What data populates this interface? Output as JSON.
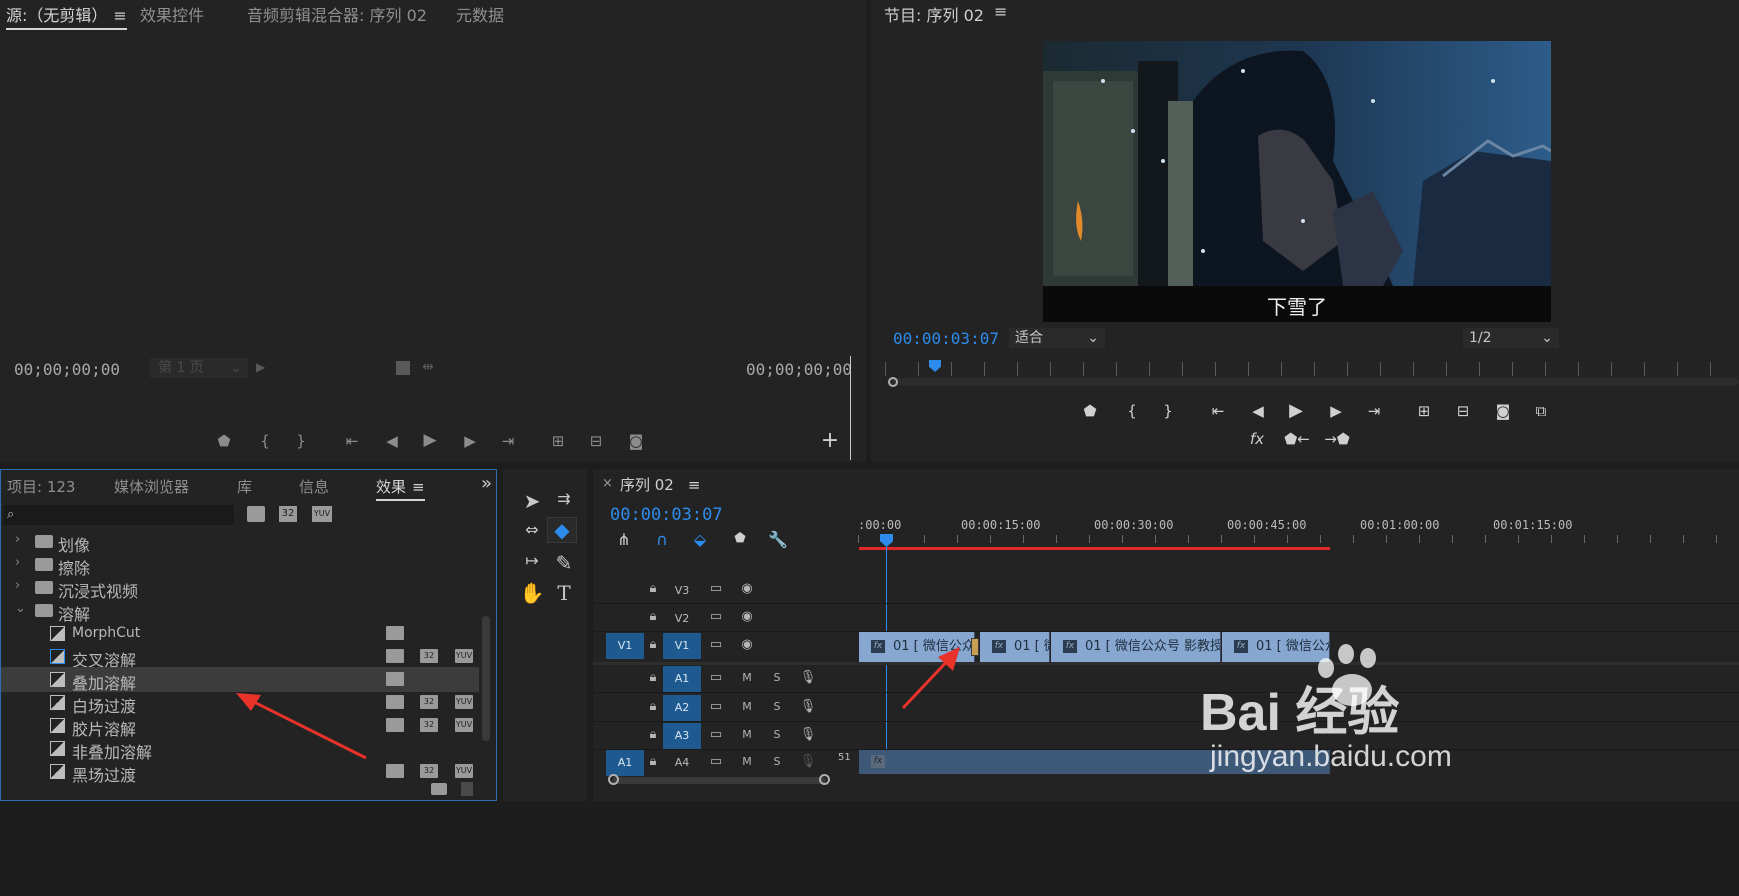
{
  "source": {
    "tabs": [
      {
        "label": "源:（无剪辑）",
        "active": true
      },
      {
        "label": "效果控件"
      },
      {
        "label": "音频剪辑混合器: 序列 02"
      },
      {
        "label": "元数据"
      }
    ],
    "menu_glyph": "≡",
    "timecode_left": "00;00;00;00",
    "timecode_right": "00;00;00;00",
    "page_select": "第 1 页",
    "add_glyph": "+"
  },
  "program": {
    "title": "节目: 序列 02",
    "menu_glyph": "≡",
    "subtitle": "下雪了",
    "timecode": "00:00:03:07",
    "fit_select": "适合",
    "quality_select": "1/2",
    "fx_label": "fx"
  },
  "project": {
    "tabs": [
      {
        "label": "项目: 123"
      },
      {
        "label": "媒体浏览器"
      },
      {
        "label": "库"
      },
      {
        "label": "信息"
      },
      {
        "label": "效果",
        "active": true
      }
    ],
    "menu_glyph": "≡",
    "overflow_glyph": "»",
    "search_placeholder": "",
    "filter_badges": [
      "32",
      "YUV"
    ],
    "items": [
      {
        "label": "划像",
        "type": "folder",
        "expanded": false
      },
      {
        "label": "擦除",
        "type": "folder",
        "expanded": false
      },
      {
        "label": "沉浸式视频",
        "type": "folder",
        "expanded": false
      },
      {
        "label": "溶解",
        "type": "folder",
        "expanded": true
      },
      {
        "label": "MorphCut",
        "type": "effect",
        "badges": [
          "accel"
        ]
      },
      {
        "label": "交叉溶解",
        "type": "effect",
        "badges": [
          "accel",
          "32",
          "YUV"
        ]
      },
      {
        "label": "叠加溶解",
        "type": "effect",
        "badges": [
          "accel"
        ],
        "selected": true
      },
      {
        "label": "白场过渡",
        "type": "effect",
        "badges": [
          "accel",
          "32",
          "YUV"
        ]
      },
      {
        "label": "胶片溶解",
        "type": "effect",
        "badges": [
          "accel",
          "32",
          "YUV"
        ]
      },
      {
        "label": "非叠加溶解",
        "type": "effect",
        "badges": []
      },
      {
        "label": "黑场过渡",
        "type": "effect",
        "badges": [
          "accel",
          "32",
          "YUV"
        ]
      }
    ]
  },
  "sequence": {
    "close_glyph": "×",
    "title": "序列 02",
    "menu_glyph": "≡",
    "timecode": "00:00:03:07",
    "ruler": [
      ":00:00",
      "00:00:15:00",
      "00:00:30:00",
      "00:00:45:00",
      "00:01:00:00",
      "00:01:15:00"
    ],
    "video_tracks": [
      {
        "name": "V3"
      },
      {
        "name": "V2"
      },
      {
        "name": "V1",
        "source": "V1"
      }
    ],
    "audio_tracks": [
      {
        "name": "A1",
        "m": "M",
        "s": "S"
      },
      {
        "name": "A2",
        "m": "M",
        "s": "S"
      },
      {
        "name": "A3",
        "m": "M",
        "s": "S"
      },
      {
        "name": "A4",
        "source": "A1",
        "m": "M",
        "s": "S",
        "level": "51"
      }
    ],
    "clips": [
      {
        "label": "01 [ 微信公众"
      },
      {
        "label": "01 [ 微"
      },
      {
        "label": "01 [ 微信公众号 影教授 ]"
      },
      {
        "label": "01 [ 微信公众"
      }
    ],
    "fx_badge": "fx"
  },
  "watermark": {
    "text": "Bai 经验",
    "url": "jingyan.baidu.com"
  },
  "colors": {
    "accent_blue": "#2d8ceb",
    "track_blue": "#1e5a8f",
    "clip_blue": "#87a7d0",
    "red_bar": "#e0282a",
    "arrow_red": "#e8322a"
  }
}
